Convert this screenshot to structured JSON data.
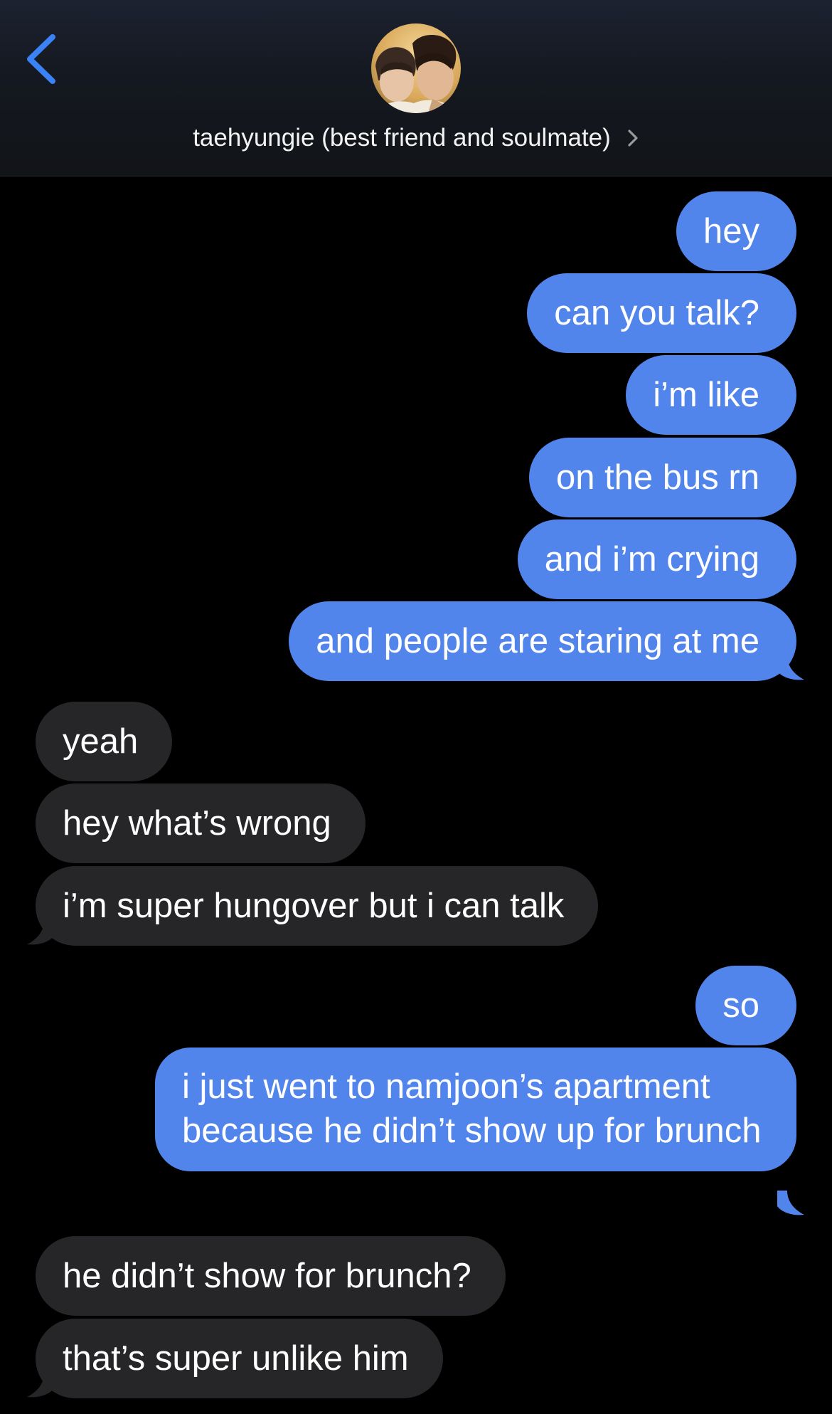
{
  "header": {
    "contact_name": "taehyungie (best friend and soulmate)"
  },
  "messages": [
    {
      "direction": "sent",
      "text": "hey"
    },
    {
      "direction": "sent",
      "text": "can you talk?"
    },
    {
      "direction": "sent",
      "text": "i’m like"
    },
    {
      "direction": "sent",
      "text": "on the bus rn"
    },
    {
      "direction": "sent",
      "text": "and i’m crying"
    },
    {
      "direction": "sent",
      "text": "and people are staring at me"
    },
    {
      "direction": "received",
      "text": "yeah"
    },
    {
      "direction": "received",
      "text": "hey what’s wrong"
    },
    {
      "direction": "received",
      "text": "i’m super hungover but i can talk"
    },
    {
      "direction": "sent",
      "text": "so"
    },
    {
      "direction": "sent",
      "text": "i just went to namjoon’s apartment because he didn’t show up for brunch"
    },
    {
      "direction": "received",
      "text": "he didn’t show for brunch?"
    },
    {
      "direction": "received",
      "text": "that’s super unlike him"
    }
  ],
  "colors": {
    "sent_bubble": "#5185ec",
    "received_bubble": "#262628",
    "accent": "#3b82f6"
  },
  "icons": {
    "back": "chevron-left-icon",
    "name_chevron": "chevron-right-icon"
  }
}
